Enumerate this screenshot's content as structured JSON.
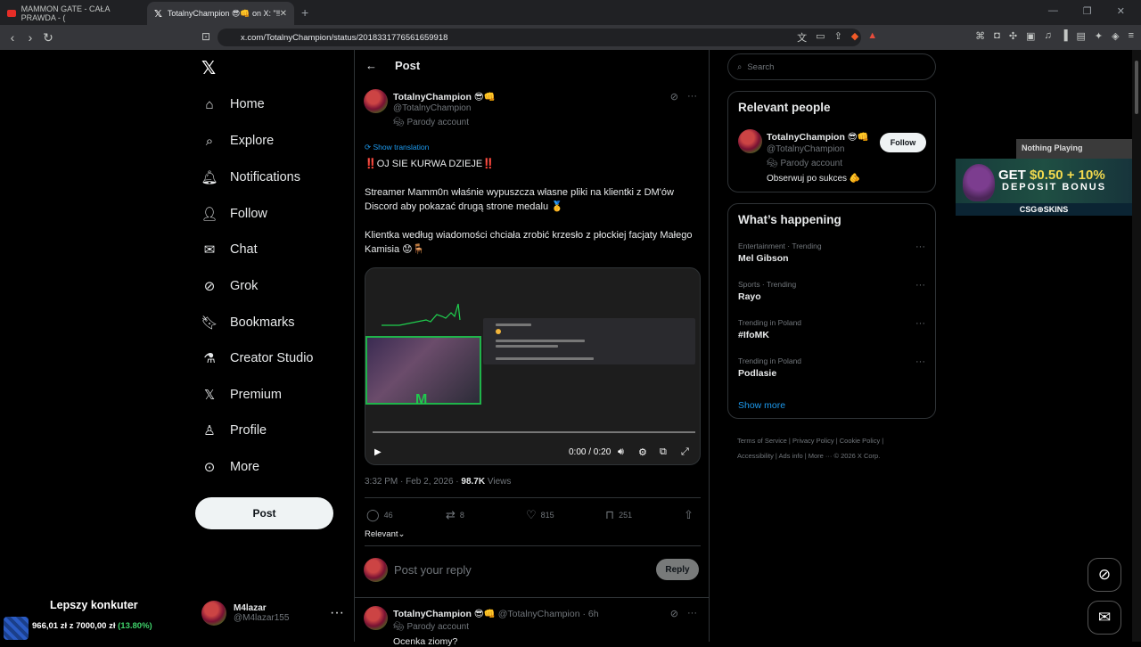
{
  "browser": {
    "tabs": [
      {
        "title": "MAMMON GATE - CAŁA PRAWDA - (",
        "icon": "youtube-icon"
      },
      {
        "title": "TotalnyChampion 😎👊 on X: \"‼",
        "icon": "x-icon"
      }
    ],
    "url": "x.com/TotalnyChampion/status/2018331776561659918",
    "badge_count": "1"
  },
  "nav": {
    "items": [
      {
        "label": "Home",
        "icon": "home-icon"
      },
      {
        "label": "Explore",
        "icon": "search-icon"
      },
      {
        "label": "Notifications",
        "icon": "bell-icon"
      },
      {
        "label": "Follow",
        "icon": "add-user-icon"
      },
      {
        "label": "Chat",
        "icon": "mail-icon"
      },
      {
        "label": "Grok",
        "icon": "grok-icon"
      },
      {
        "label": "Bookmarks",
        "icon": "bookmark-icon"
      },
      {
        "label": "Creator Studio",
        "icon": "flask-icon"
      },
      {
        "label": "Premium",
        "icon": "x-icon"
      },
      {
        "label": "Profile",
        "icon": "person-icon"
      },
      {
        "label": "More",
        "icon": "more-circle-icon"
      }
    ],
    "post_button": "Post",
    "account": {
      "name": "M4lazar",
      "handle": "@M4lazar155"
    }
  },
  "promo": {
    "title": "Lepszy konkuter",
    "value": "966,01 zł",
    "sep": "z",
    "target": "7000,00 zł",
    "pct": "(13.80%)"
  },
  "header": {
    "title": "Post"
  },
  "post": {
    "name": "TotalnyChampion 😎👊",
    "handle": "@TotalnyChampion",
    "parody": "Parody account",
    "show_translation": "Show translation",
    "text": "‼️OJ SIE KURWA DZIEJE‼️\n\nStreamer Mamm0n właśnie wypuszcza własne pliki na klientki z DM'ów Discord aby pokazać drugą strone medalu 🥇\n\nKlientka według wiadomości chciała zrobić krzesło z płockiej facjaty Małego Kamisia 😟🪑",
    "video_time": "0:00 / 0:20",
    "time": "3:32 PM · Feb 2, 2026 · ",
    "views_count": "98.7K",
    "views_label": " Views",
    "replies": "46",
    "reposts": "8",
    "likes": "815",
    "bookmarks": "251",
    "sort": "Relevant",
    "reply_placeholder": "Post your reply",
    "reply_button": "Reply"
  },
  "reply": {
    "name": "TotalnyChampion 😎👊",
    "meta": "@TotalnyChampion · 6h",
    "parody": "Parody account",
    "text": "Ocenka ziomy?"
  },
  "sidebar": {
    "search_placeholder": "Search",
    "relevant_title": "Relevant people",
    "person": {
      "name": "TotalnyChampion 😎👊",
      "handle": "@TotalnyChampion",
      "parody": "Parody account",
      "bio": "Obserwuj po sukces 🫵",
      "follow": "Follow"
    },
    "happening_title": "What’s happening",
    "trends": [
      {
        "category": "Entertainment · Trending",
        "name": "Mel Gibson"
      },
      {
        "category": "Sports · Trending",
        "name": "Rayo"
      },
      {
        "category": "Trending in Poland",
        "name": "#IfoMK"
      },
      {
        "category": "Trending in Poland",
        "name": "Podlasie"
      }
    ],
    "show_more": "Show more",
    "footer": "Terms of Service | Privacy Policy | Cookie Policy | Accessibility | Ads info | More ··· © 2026 X Corp."
  },
  "overlay": {
    "now_playing": "Nothing Playing",
    "ad_line1_a": "GET ",
    "ad_line1_b": "$0.50 + 10%",
    "ad_line2": "DEPOSIT BONUS",
    "ad_brand": "CSG⊕SKINS"
  }
}
